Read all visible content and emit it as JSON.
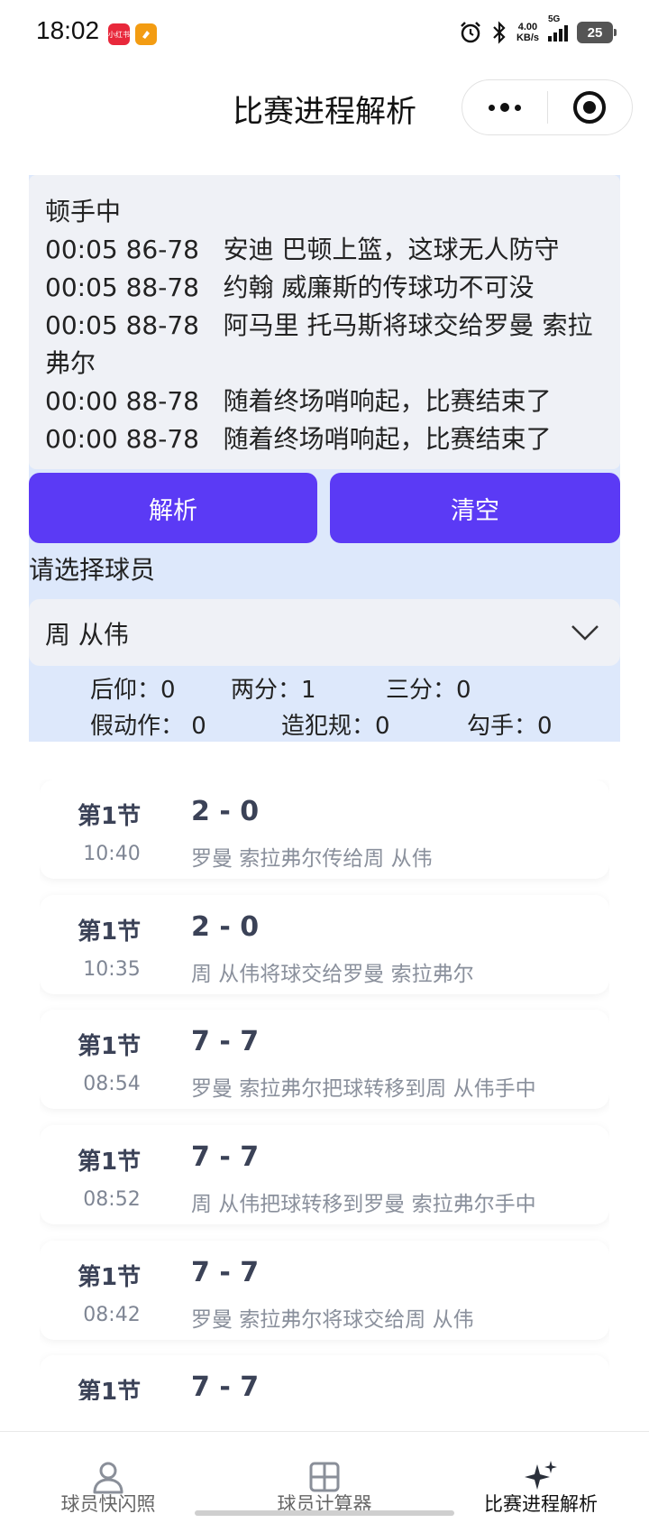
{
  "status_bar": {
    "time": "18:02",
    "app_badges": [
      "小红书",
      ""
    ],
    "net_speed_value": "4.00",
    "net_speed_unit": "KB/s",
    "network": "5G",
    "battery": "25",
    "icons": [
      "alarm-icon",
      "bluetooth-icon",
      "signal-icon",
      "battery-icon"
    ]
  },
  "nav": {
    "title": "比赛进程解析",
    "capsule_icons": [
      "more-icon",
      "close-target-icon"
    ]
  },
  "log": {
    "lines": [
      "顿手中",
      "00:05 86-78   安迪 巴顿上篮，这球无人防守",
      "00:05 88-78   约翰 威廉斯的传球功不可没",
      "00:05 88-78   阿马里 托马斯将球交给罗曼 索拉弗尔",
      "00:00 88-78   随着终场哨响起，比赛结束了",
      "00:00 88-78   随着终场哨响起，比赛结束了"
    ]
  },
  "buttons": {
    "parse": "解析",
    "clear": "清空"
  },
  "player_select": {
    "label": "请选择球员",
    "selected": "周 从伟"
  },
  "stats": {
    "fadeaway": "后仰：0",
    "two_pt": "两分：1",
    "three_pt": "三分：0",
    "fake": "假动作：  0",
    "foul_drawn": "造犯规：0",
    "hook": "勾手：0"
  },
  "events": [
    {
      "period": "第1节",
      "time": "10:40",
      "score": "2 -  0",
      "desc": "罗曼 索拉弗尔传给周 从伟"
    },
    {
      "period": "第1节",
      "time": "10:35",
      "score": "2 -  0",
      "desc": "周 从伟将球交给罗曼 索拉弗尔"
    },
    {
      "period": "第1节",
      "time": "08:54",
      "score": "7 -  7",
      "desc": "罗曼 索拉弗尔把球转移到周 从伟手中"
    },
    {
      "period": "第1节",
      "time": "08:52",
      "score": "7 -  7",
      "desc": "周 从伟把球转移到罗曼 索拉弗尔手中"
    },
    {
      "period": "第1节",
      "time": "08:42",
      "score": "7 -  7",
      "desc": "罗曼 索拉弗尔将球交给周 从伟"
    },
    {
      "period": "第1节",
      "time": "",
      "score": "7 -  7",
      "desc": ""
    }
  ],
  "tabbar": {
    "tabs": [
      {
        "label": "球员快闪照",
        "icon": "person-icon",
        "active": false
      },
      {
        "label": "球员计算器",
        "icon": "grid-icon",
        "active": false
      },
      {
        "label": "比赛进程解析",
        "icon": "sparkle-icon",
        "active": true
      }
    ]
  }
}
